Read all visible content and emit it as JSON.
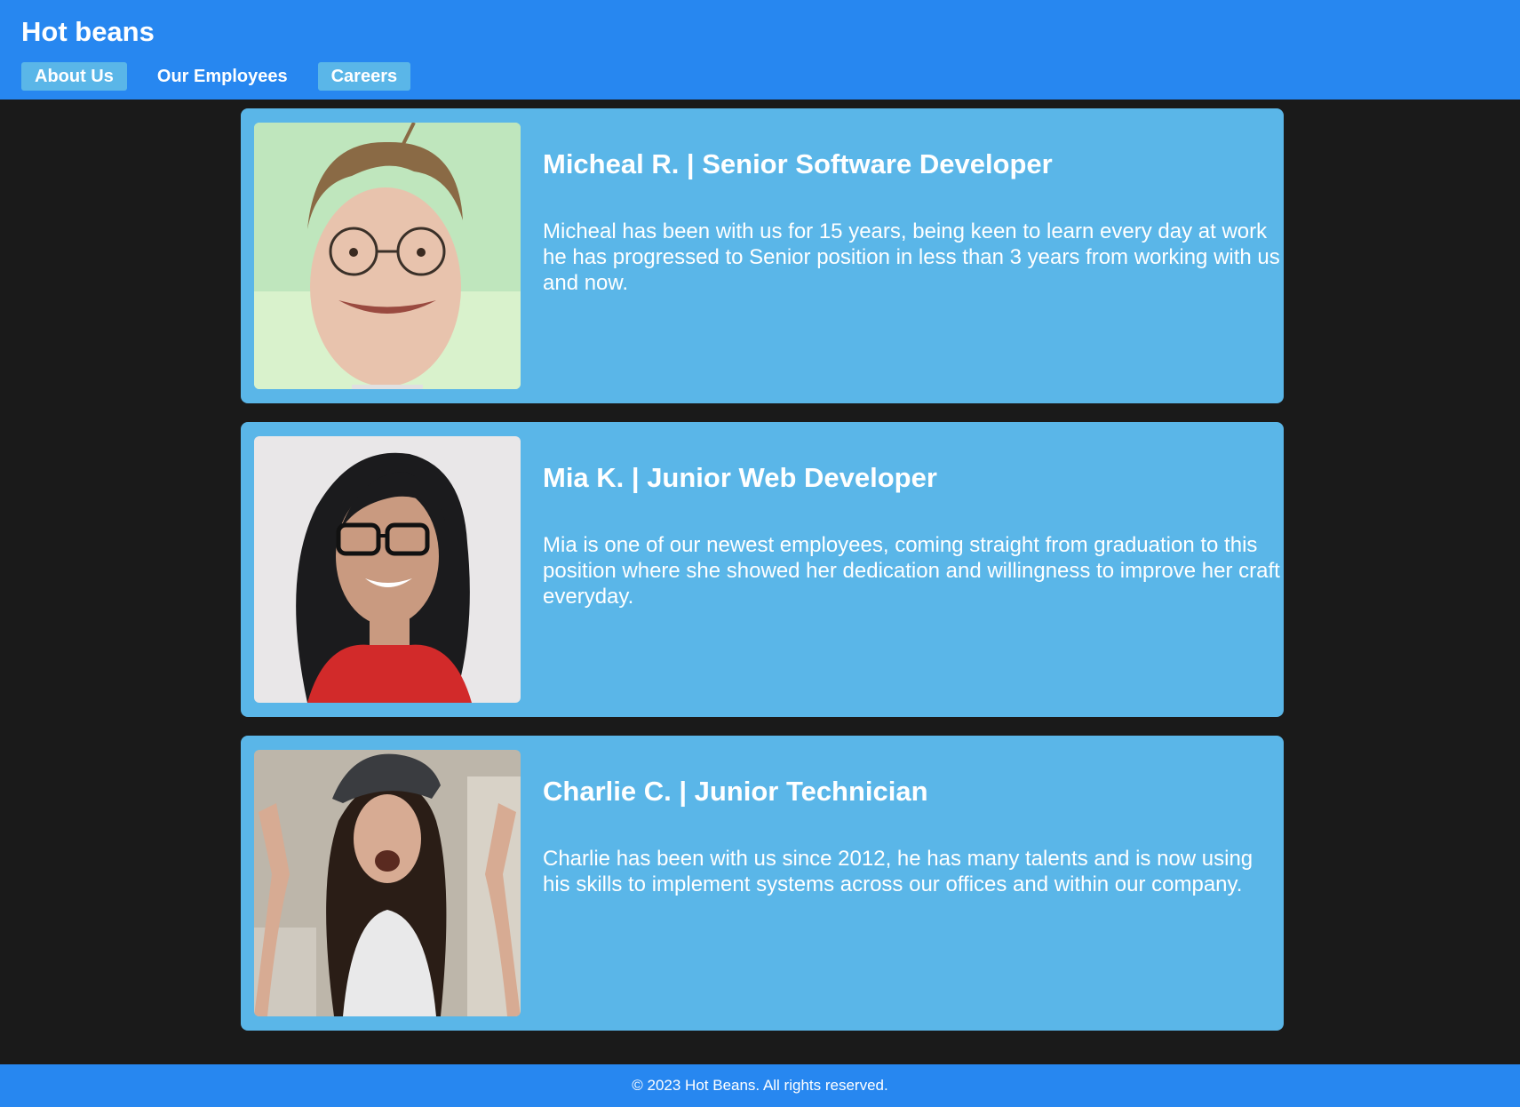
{
  "header": {
    "title": "Hot beans",
    "nav": [
      {
        "label": "About Us",
        "active": true
      },
      {
        "label": "Our Employees",
        "active": false
      },
      {
        "label": "Careers",
        "active": true
      }
    ]
  },
  "employees": [
    {
      "heading": "Micheal R. | Senior Software Developer",
      "bio": "Micheal has been with us for 15 years, being keen to learn every day at work he has progressed to Senior position in less than 3 years from working with us and now."
    },
    {
      "heading": "Mia K. | Junior Web Developer",
      "bio": "Mia is one of our newest employees, coming straight from graduation to this position where she showed her dedication and willingness to improve her craft everyday."
    },
    {
      "heading": "Charlie C. | Junior Technician",
      "bio": "Charlie has been with us since 2012, he has many talents and is now using his skills to implement systems across our offices and within our company."
    }
  ],
  "footer": {
    "text": "© 2023 Hot Beans. All rights reserved."
  },
  "colors": {
    "header": "#2787f0",
    "card": "#5ab6e8",
    "background": "#1a1a1a"
  }
}
